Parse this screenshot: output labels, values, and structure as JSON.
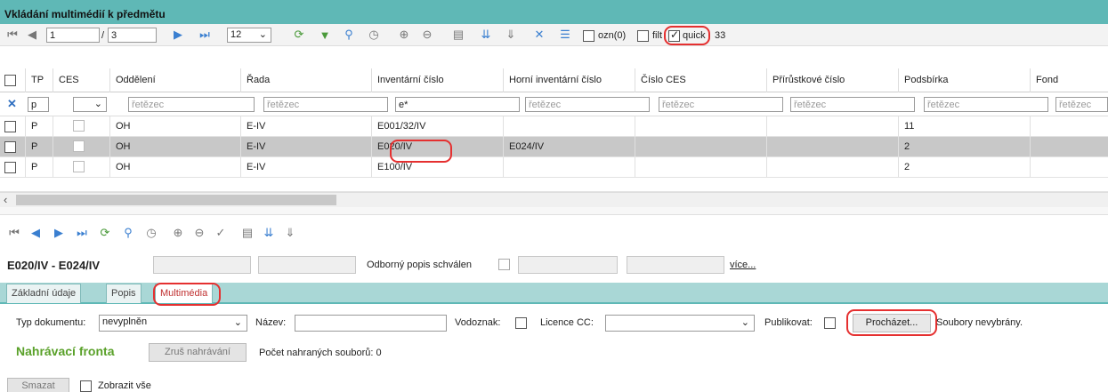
{
  "title": "Vkládání multimédií k předmětu",
  "colors": {
    "teal": "#5fb8b6",
    "accent_green": "#5aa12a",
    "highlight": "#e53030",
    "link_blue": "#3a7fd0"
  },
  "pager": {
    "page": "1",
    "separator": "/",
    "total_pages": "3",
    "page_size": "12"
  },
  "top_toolbar": {
    "ozn_label": "ozn(0)",
    "filt_label": "filt",
    "quick_label": "quick",
    "count": "33"
  },
  "table": {
    "columns": [
      "TP",
      "CES",
      "Oddělení",
      "Řada",
      "Inventární číslo",
      "Horní inventární číslo",
      "Číslo CES",
      "Přírůstkové číslo",
      "Podsbírka",
      "Fond"
    ],
    "filters": {
      "tp": "p",
      "oddeleni": "řetězec",
      "rada": "řetězec",
      "inv": "e*",
      "horni": "řetězec",
      "ces": "řetězec",
      "prir": "řetězec",
      "podsbirka": "řetězec",
      "fond": "řetězec"
    },
    "rows": [
      {
        "tp": "P",
        "oddeleni": "OH",
        "rada": "E-IV",
        "inv": "E001/32/IV",
        "horni": "",
        "podsbirka": "11"
      },
      {
        "tp": "P",
        "oddeleni": "OH",
        "rada": "E-IV",
        "inv": "E020/IV",
        "horni": "E024/IV",
        "podsbirka": "2"
      },
      {
        "tp": "P",
        "oddeleni": "OH",
        "rada": "E-IV",
        "inv": "E100/IV",
        "horni": "",
        "podsbirka": "2"
      }
    ]
  },
  "detail": {
    "record_title": "E020/IV - E024/IV",
    "odborny_label": "Odborný popis schválen",
    "vice_link": "více..."
  },
  "tabs": [
    "Základní údaje",
    "Popis",
    "Multimédia"
  ],
  "form": {
    "typ_label": "Typ dokumentu:",
    "typ_value": "nevyplněn",
    "nazev_label": "Název:",
    "vodoznak_label": "Vodoznak:",
    "licence_label": "Licence CC:",
    "publikovat_label": "Publikovat:",
    "browse_label": "Procházet...",
    "no_files": "Soubory nevybrány."
  },
  "queue": {
    "title": "Nahrávací fronta",
    "cancel_label": "Zruš nahrávání",
    "count_text": "Počet nahraných souborů: 0"
  },
  "bottom": {
    "delete_label": "Smazat",
    "show_all_label": "Zobrazit vše"
  }
}
